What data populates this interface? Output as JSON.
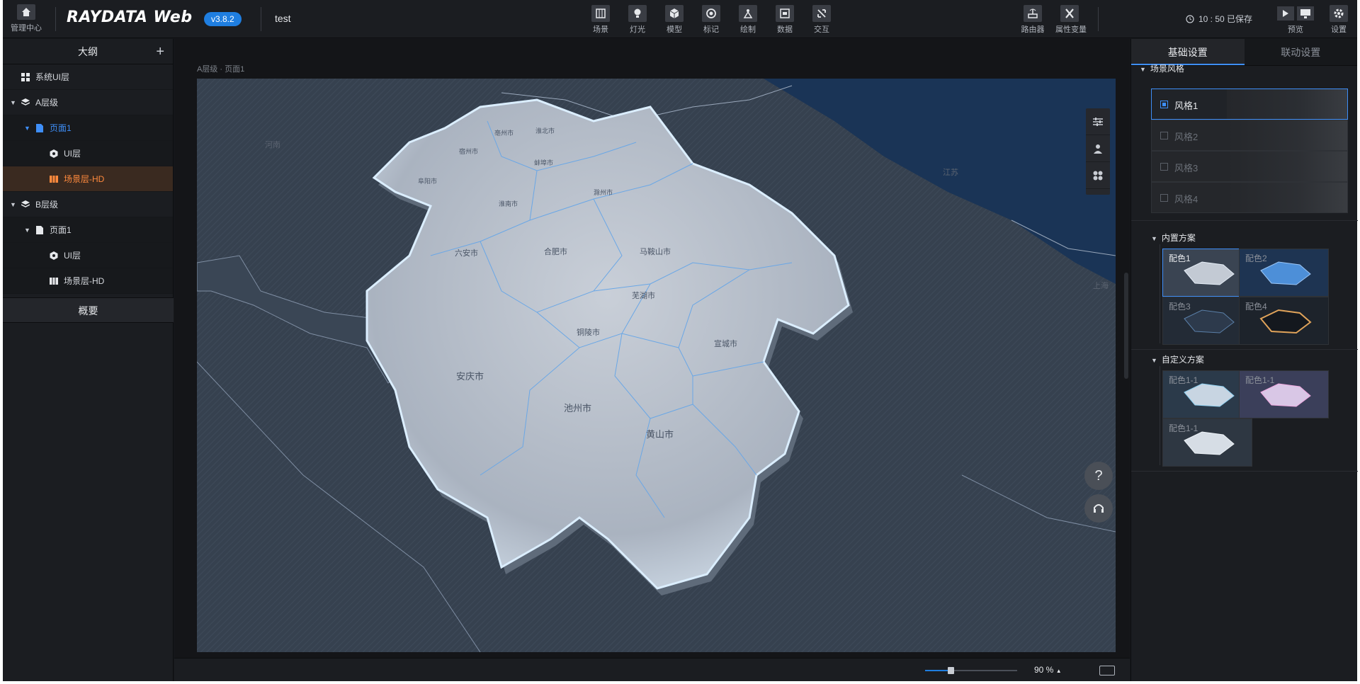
{
  "header": {
    "home_label": "管理中心",
    "logo": "RAYDATA Web",
    "version": "v3.8.2",
    "project": "test",
    "tools": [
      {
        "label": "场景",
        "icon": "scene-icon"
      },
      {
        "label": "灯光",
        "icon": "light-icon"
      },
      {
        "label": "模型",
        "icon": "model-icon"
      },
      {
        "label": "标记",
        "icon": "marker-icon"
      },
      {
        "label": "绘制",
        "icon": "draw-icon"
      },
      {
        "label": "数据",
        "icon": "data-icon"
      },
      {
        "label": "交互",
        "icon": "interact-icon"
      }
    ],
    "right_tools": [
      {
        "label": "路由器",
        "icon": "router-icon"
      },
      {
        "label": "属性变量",
        "icon": "variable-icon"
      }
    ],
    "save_status": "10 : 50 已保存",
    "preview_label": "预览",
    "settings_label": "设置"
  },
  "outline": {
    "title": "大纲",
    "items": [
      {
        "label": "系统UI层",
        "icon": "grid-icon"
      },
      {
        "label": "A层级",
        "icon": "layers-icon"
      },
      {
        "label": "页面1",
        "icon": "page-icon"
      },
      {
        "label": "UI层",
        "icon": "ui-layer-icon"
      },
      {
        "label": "场景层-HD",
        "icon": "scene-layer-icon"
      },
      {
        "label": "B层级",
        "icon": "layers-icon"
      },
      {
        "label": "页面1",
        "icon": "page-icon"
      },
      {
        "label": "UI层",
        "icon": "ui-layer-icon"
      },
      {
        "label": "场景层-HD",
        "icon": "scene-layer-icon"
      }
    ],
    "overview": "概要"
  },
  "canvas": {
    "breadcrumb": "A层级 · 页面1",
    "region_labels": [
      "河南",
      "江苏",
      "上海"
    ],
    "cities": [
      "亳州市",
      "淮北市",
      "宿州市",
      "蚌埠市",
      "阜阳市",
      "淮南市",
      "滁州市",
      "六安市",
      "合肥市",
      "马鞍山市",
      "芜湖市",
      "铜陵市",
      "宣城市",
      "安庆市",
      "池州市",
      "黄山市"
    ],
    "help": "?",
    "zoom": "90 %",
    "zoom_fraction": 0.28
  },
  "panel": {
    "tabs": [
      "基础设置",
      "联动设置"
    ],
    "scene_style_title": "场景风格",
    "styles": [
      "风格1",
      "风格2",
      "风格3",
      "风格4"
    ],
    "builtin_title": "内置方案",
    "builtin": [
      "配色1",
      "配色2",
      "配色3",
      "配色4"
    ],
    "custom_title": "自定义方案",
    "custom": [
      "配色1-1",
      "配色1-1",
      "配色1-1"
    ]
  }
}
